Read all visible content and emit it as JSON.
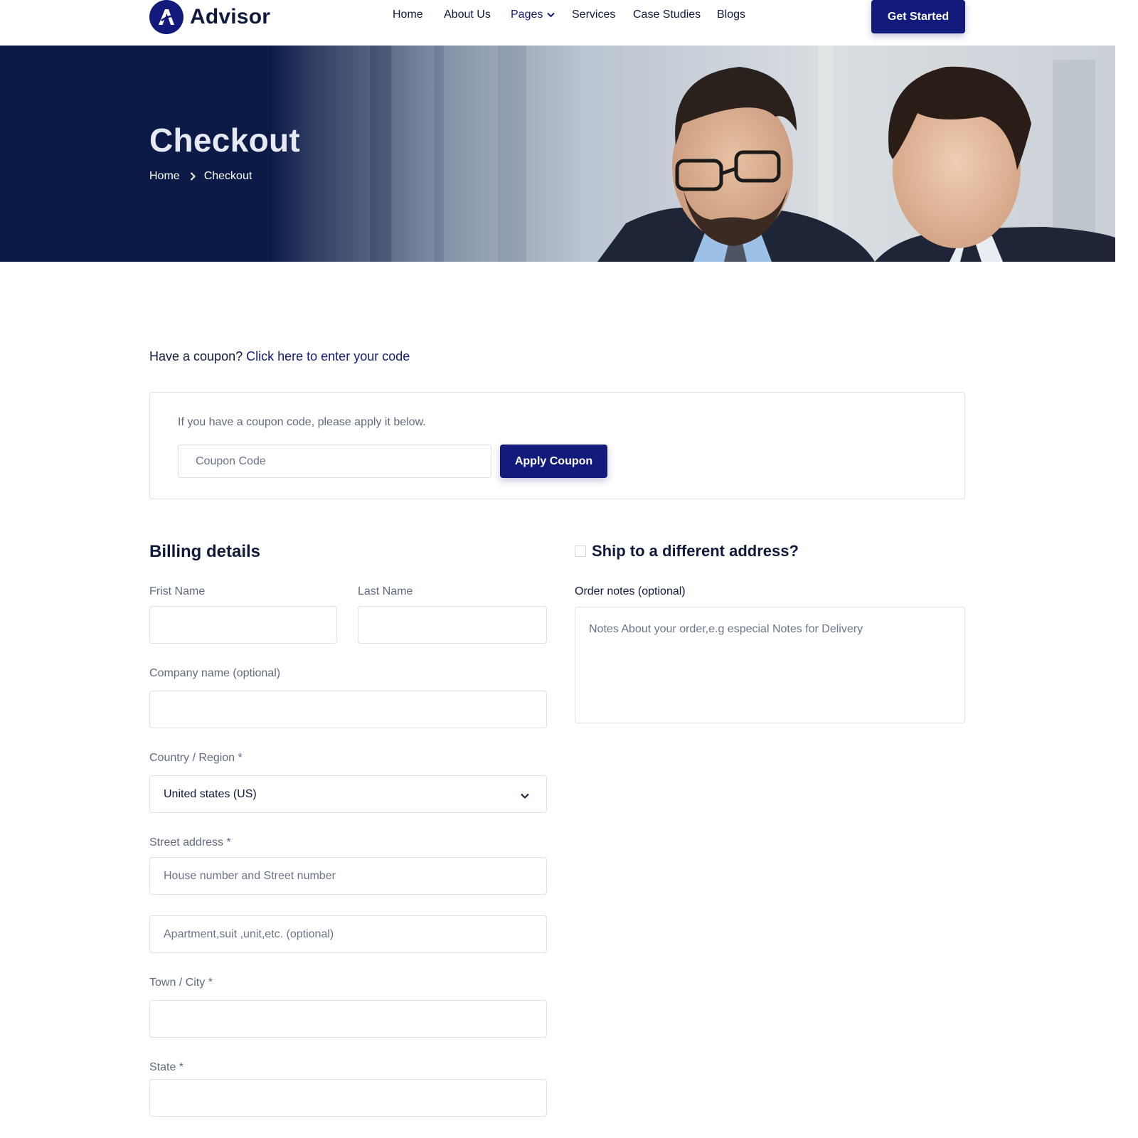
{
  "brand": {
    "name": "Advisor",
    "logo_letter": "A",
    "primary_color": "#121a7c",
    "text_color": "#0f1a3c"
  },
  "nav": {
    "items": [
      {
        "label": "Home"
      },
      {
        "label": "About Us"
      },
      {
        "label": "Pages",
        "has_dropdown": true,
        "active": true
      },
      {
        "label": "Services"
      },
      {
        "label": "Case Studies"
      },
      {
        "label": "Blogs"
      }
    ],
    "cta_label": "Get Started"
  },
  "hero": {
    "title": "Checkout",
    "breadcrumb": [
      "Home",
      "Checkout"
    ],
    "image_alt": "Two businessmen in suits looking down"
  },
  "coupon": {
    "question": "Have a coupon?",
    "link_text": "Click here to enter your code",
    "note": "If you have a coupon code, please apply it below.",
    "input_placeholder": "Coupon Code",
    "apply_label": "Apply Coupon"
  },
  "billing": {
    "title": "Billing details",
    "first_name_label": "Frist Name",
    "last_name_label": "Last Name",
    "company_label": "Company name (optional)",
    "country_label": "Country / Region *",
    "country_value": "United states (US)",
    "street_label": "Street address *",
    "street_placeholder": "House number and Street number",
    "apartment_placeholder": "Apartment,suit ,unit,etc. (optional)",
    "city_label": "Town / City *",
    "state_label": "State *"
  },
  "shipping": {
    "ship_label": "Ship to a different address?",
    "ship_checked": false,
    "notes_label": "Order notes (optional)",
    "notes_placeholder": "Notes About your order,e.g especial Notes for Delivery"
  }
}
